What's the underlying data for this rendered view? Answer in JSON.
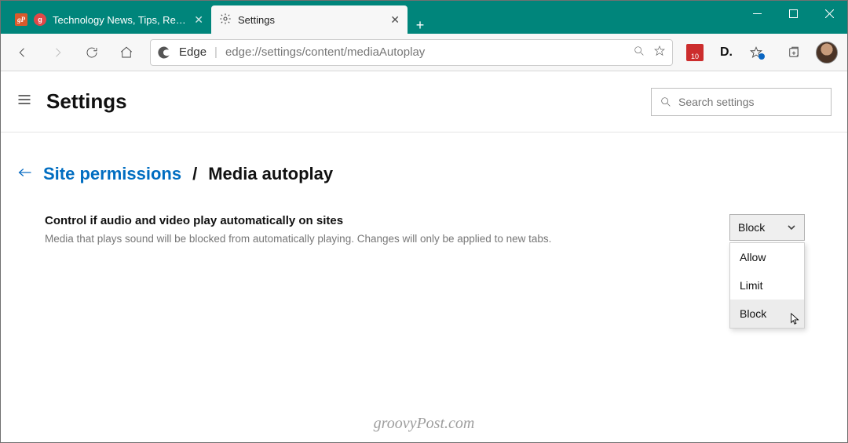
{
  "tabs": [
    {
      "title": "Technology News, Tips, Reviews…",
      "favicon": "gp"
    },
    {
      "title": "Settings",
      "favicon": "gear"
    }
  ],
  "toolbar": {
    "browser_label": "Edge",
    "url": "edge://settings/content/mediaAutoplay"
  },
  "extensions": {
    "badge_count": "10",
    "letter": "D."
  },
  "header": {
    "title": "Settings",
    "search_placeholder": "Search settings"
  },
  "breadcrumb": {
    "parent": "Site permissions",
    "separator": "/",
    "current": "Media autoplay"
  },
  "setting": {
    "title": "Control if audio and video play automatically on sites",
    "description": "Media that plays sound will be blocked from automatically playing. Changes will only be applied to new tabs."
  },
  "dropdown": {
    "selected": "Block",
    "options": [
      "Allow",
      "Limit",
      "Block"
    ],
    "hovered_index": 2
  },
  "watermark": "groovyPost.com"
}
